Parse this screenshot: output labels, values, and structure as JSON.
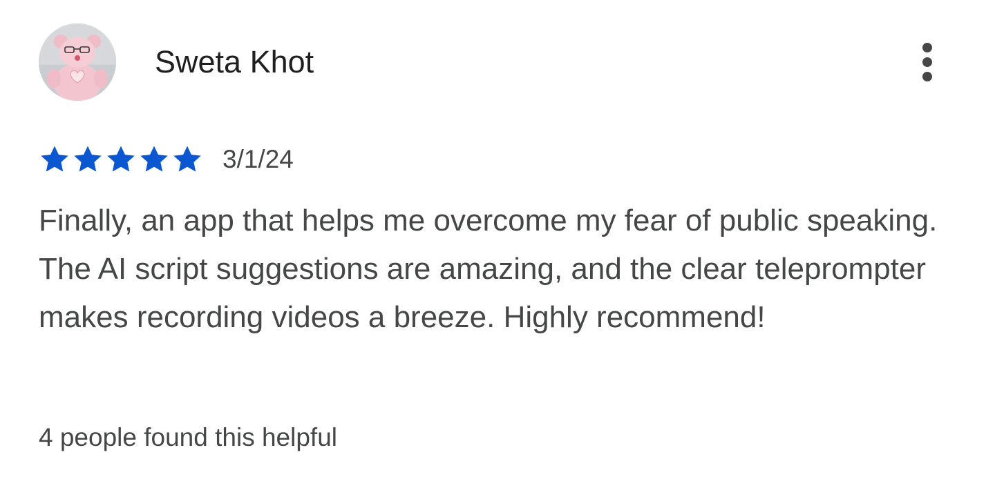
{
  "reviewer": {
    "name": "Sweta Khot",
    "avatar_icon": "teddy-bear-avatar"
  },
  "menu": {
    "icon": "more-vert-icon"
  },
  "rating": {
    "stars": 5,
    "max_stars": 5,
    "star_color": "#0b57d0",
    "date": "3/1/24"
  },
  "review": {
    "text": "Finally, an app that helps me overcome my fear of public speaking. The AI script suggestions are amazing, and the clear teleprompter makes recording videos a breeze. Highly recommend!"
  },
  "helpful": {
    "text": "4 people found this helpful"
  }
}
